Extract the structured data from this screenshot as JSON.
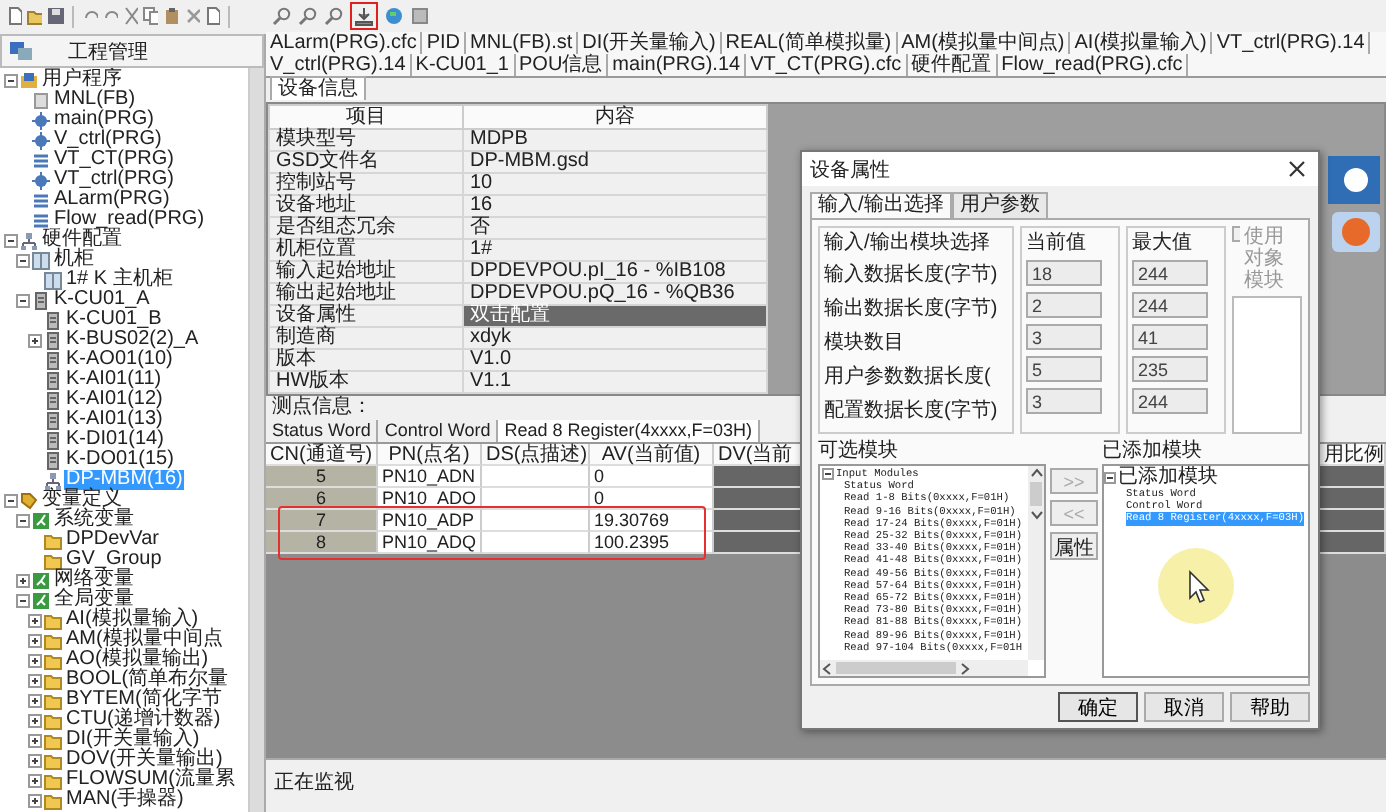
{
  "project_panel": {
    "title": "工程管理",
    "tree": [
      {
        "label": "用户程序",
        "kind": "root",
        "expanded": true,
        "selected": false,
        "children": [
          {
            "label": "MNL(FB)",
            "kind": "fb",
            "selected": false
          },
          {
            "label": "main(PRG)",
            "kind": "program",
            "selected": false
          },
          {
            "label": "V_ctrl(PRG)",
            "kind": "program",
            "selected": false
          },
          {
            "label": "VT_CT(PRG)",
            "kind": "chart",
            "selected": false
          },
          {
            "label": "VT_ctrl(PRG)",
            "kind": "program",
            "selected": false
          },
          {
            "label": "ALarm(PRG)",
            "kind": "chart",
            "selected": false
          },
          {
            "label": "Flow_read(PRG)",
            "kind": "chart",
            "selected": false
          }
        ]
      },
      {
        "label": "硬件配置",
        "kind": "hardware",
        "expanded": true,
        "selected": false,
        "children": [
          {
            "label": "机柜",
            "kind": "cabinet",
            "expanded": true,
            "selected": false,
            "children": [
              {
                "label": "1# K 主机柜",
                "kind": "cabinet",
                "selected": false
              }
            ]
          },
          {
            "label": "K-CU01_A",
            "kind": "module",
            "expanded": true,
            "selected": false,
            "children": [
              {
                "label": "K-CU01_B",
                "kind": "module",
                "selected": false
              },
              {
                "label": "K-BUS02(2)_A",
                "kind": "module",
                "expanded": false,
                "selected": false
              },
              {
                "label": "K-AO01(10)",
                "kind": "module",
                "selected": false
              },
              {
                "label": "K-AI01(11)",
                "kind": "module",
                "selected": false
              },
              {
                "label": "K-AI01(12)",
                "kind": "module",
                "selected": false
              },
              {
                "label": "K-AI01(13)",
                "kind": "module",
                "selected": false
              },
              {
                "label": "K-DI01(14)",
                "kind": "module",
                "selected": false
              },
              {
                "label": "K-DO01(15)",
                "kind": "module",
                "selected": false
              },
              {
                "label": "DP-MBM(16)",
                "kind": "hardware",
                "selected": true
              }
            ]
          }
        ]
      },
      {
        "label": "变量定义",
        "kind": "tag",
        "expanded": true,
        "selected": false,
        "children": [
          {
            "label": "系统变量",
            "kind": "group",
            "expanded": true,
            "selected": false,
            "children": [
              {
                "label": "DPDevVar",
                "kind": "folder",
                "selected": false
              },
              {
                "label": "GV_Group",
                "kind": "folder",
                "selected": false
              }
            ]
          },
          {
            "label": "网络变量",
            "kind": "group",
            "expanded": false,
            "selected": false
          },
          {
            "label": "全局变量",
            "kind": "group",
            "expanded": true,
            "selected": false,
            "children": [
              {
                "label": "AI(模拟量输入)",
                "kind": "folder",
                "expanded": false,
                "selected": false
              },
              {
                "label": "AM(模拟量中间点",
                "kind": "folder",
                "expanded": false,
                "selected": false
              },
              {
                "label": "AO(模拟量输出)",
                "kind": "folder",
                "expanded": false,
                "selected": false
              },
              {
                "label": "BOOL(简单布尔量",
                "kind": "folder",
                "expanded": false,
                "selected": false
              },
              {
                "label": "BYTEM(简化字节",
                "kind": "folder",
                "expanded": false,
                "selected": false
              },
              {
                "label": "CTU(递增计数器)",
                "kind": "folder",
                "expanded": false,
                "selected": false
              },
              {
                "label": "DI(开关量输入)",
                "kind": "folder",
                "expanded": false,
                "selected": false
              },
              {
                "label": "DOV(开关量输出)",
                "kind": "folder",
                "expanded": false,
                "selected": false
              },
              {
                "label": "FLOWSUM(流量累",
                "kind": "folder",
                "expanded": false,
                "selected": false
              },
              {
                "label": "MAN(手操器)",
                "kind": "folder",
                "expanded": false,
                "selected": false
              }
            ]
          }
        ]
      }
    ]
  },
  "editor_tabs": [
    "ALarm(PRG).cfc",
    "PID",
    "MNL(FB).st",
    "DI(开关量输入)",
    "REAL(简单模拟量)",
    "AM(模拟量中间点)",
    "AI(模拟量输入)",
    "VT_ctrl(PRG).14",
    "V_ctrl(PRG).14",
    "K-CU01_1",
    "POU信息",
    "main(PRG).14",
    "VT_CT(PRG).cfc",
    "硬件配置",
    "Flow_read(PRG).cfc"
  ],
  "device_info": {
    "tab": "设备信息",
    "columns": [
      "项目",
      "内容"
    ],
    "rows": [
      {
        "item": "模块型号",
        "value": "MDPB",
        "selected": false
      },
      {
        "item": "GSD文件名",
        "value": "DP-MBM.gsd",
        "selected": false
      },
      {
        "item": "控制站号",
        "value": "10",
        "selected": false
      },
      {
        "item": "设备地址",
        "value": "16",
        "selected": false
      },
      {
        "item": "是否组态冗余",
        "value": "否",
        "selected": false
      },
      {
        "item": "机柜位置",
        "value": "1#",
        "selected": false
      },
      {
        "item": "输入起始地址",
        "value": "DPDEVPOU.pI_16 - %IB108",
        "selected": false
      },
      {
        "item": "输出起始地址",
        "value": "DPDEVPOU.pQ_16 - %QB36",
        "selected": false
      },
      {
        "item": "设备属性",
        "value": "双击配置",
        "selected": true
      },
      {
        "item": "制造商",
        "value": "xdyk",
        "selected": false
      },
      {
        "item": "版本",
        "value": "V1.0",
        "selected": false
      },
      {
        "item": "HW版本",
        "value": "V1.1",
        "selected": false
      }
    ]
  },
  "points": {
    "title": "测点信息：",
    "tabs": [
      {
        "label": "Status Word",
        "selected": false
      },
      {
        "label": "Control Word",
        "selected": false
      },
      {
        "label": "Read 8 Register(4xxxx,F=03H)",
        "selected": true
      }
    ],
    "columns": [
      "CN(通道号)",
      "PN(点名)",
      "DS(点描述)",
      "AV(当前值)",
      "DV(当前",
      "用比例"
    ],
    "rows": [
      {
        "cn": "5",
        "pn": "PN10_ADN",
        "av": "0"
      },
      {
        "cn": "6",
        "pn": "PN10_ADO",
        "av": "0"
      },
      {
        "cn": "7",
        "pn": "PN10_ADP",
        "av": "19.30769"
      },
      {
        "cn": "8",
        "pn": "PN10_ADQ",
        "av": "100.2395"
      }
    ]
  },
  "status_bar": "正在监视",
  "dialog": {
    "title": "设备属性",
    "tabs": [
      {
        "label": "输入/输出选择",
        "selected": true
      },
      {
        "label": "用户参数",
        "selected": false
      }
    ],
    "group_title": "输入/输出模块选择",
    "current_header": "当前值",
    "max_header": "最大值",
    "fields": [
      {
        "label": "输入数据长度(字节)",
        "current": "18",
        "max": "244"
      },
      {
        "label": "输出数据长度(字节)",
        "current": "2",
        "max": "244"
      },
      {
        "label": "模块数目",
        "current": "3",
        "max": "41"
      },
      {
        "label": "用户参数数据长度(",
        "current": "5",
        "max": "235"
      },
      {
        "label": "配置数据长度(字节)",
        "current": "3",
        "max": "244"
      }
    ],
    "object_module": {
      "label": "使用对象模块",
      "checked": false,
      "disabled": true
    },
    "available_title": "可选模块",
    "available": {
      "label": "Input Modules",
      "expanded": true,
      "children": [
        "Status Word",
        "Read 1-8 Bits(0xxxx,F=01H)",
        "Read 9-16 Bits(0xxxx,F=01H)",
        "Read 17-24 Bits(0xxxx,F=01H)",
        "Read 25-32 Bits(0xxxx,F=01H)",
        "Read 33-40 Bits(0xxxx,F=01H)",
        "Read 41-48 Bits(0xxxx,F=01H)",
        "Read 49-56 Bits(0xxxx,F=01H)",
        "Read 57-64 Bits(0xxxx,F=01H)",
        "Read 65-72 Bits(0xxxx,F=01H)",
        "Read 73-80 Bits(0xxxx,F=01H)",
        "Read 81-88 Bits(0xxxx,F=01H)",
        "Read 89-96 Bits(0xxxx,F=01H)",
        "Read 97-104 Bits(0xxxx,F=01H"
      ]
    },
    "move_buttons": [
      {
        "label": ">>",
        "disabled": true
      },
      {
        "label": "<<",
        "disabled": true
      },
      {
        "label": "属性",
        "disabled": false
      }
    ],
    "added_title": "已添加模块",
    "added": {
      "label": "已添加模块",
      "expanded": true,
      "selected": false,
      "children": [
        {
          "label": "Status Word",
          "selected": false
        },
        {
          "label": "Control Word",
          "selected": false
        },
        {
          "label": "Read 8 Register(4xxxx,F=03H)",
          "selected": true
        }
      ]
    },
    "buttons": [
      "确定",
      "取消",
      "帮助"
    ]
  }
}
